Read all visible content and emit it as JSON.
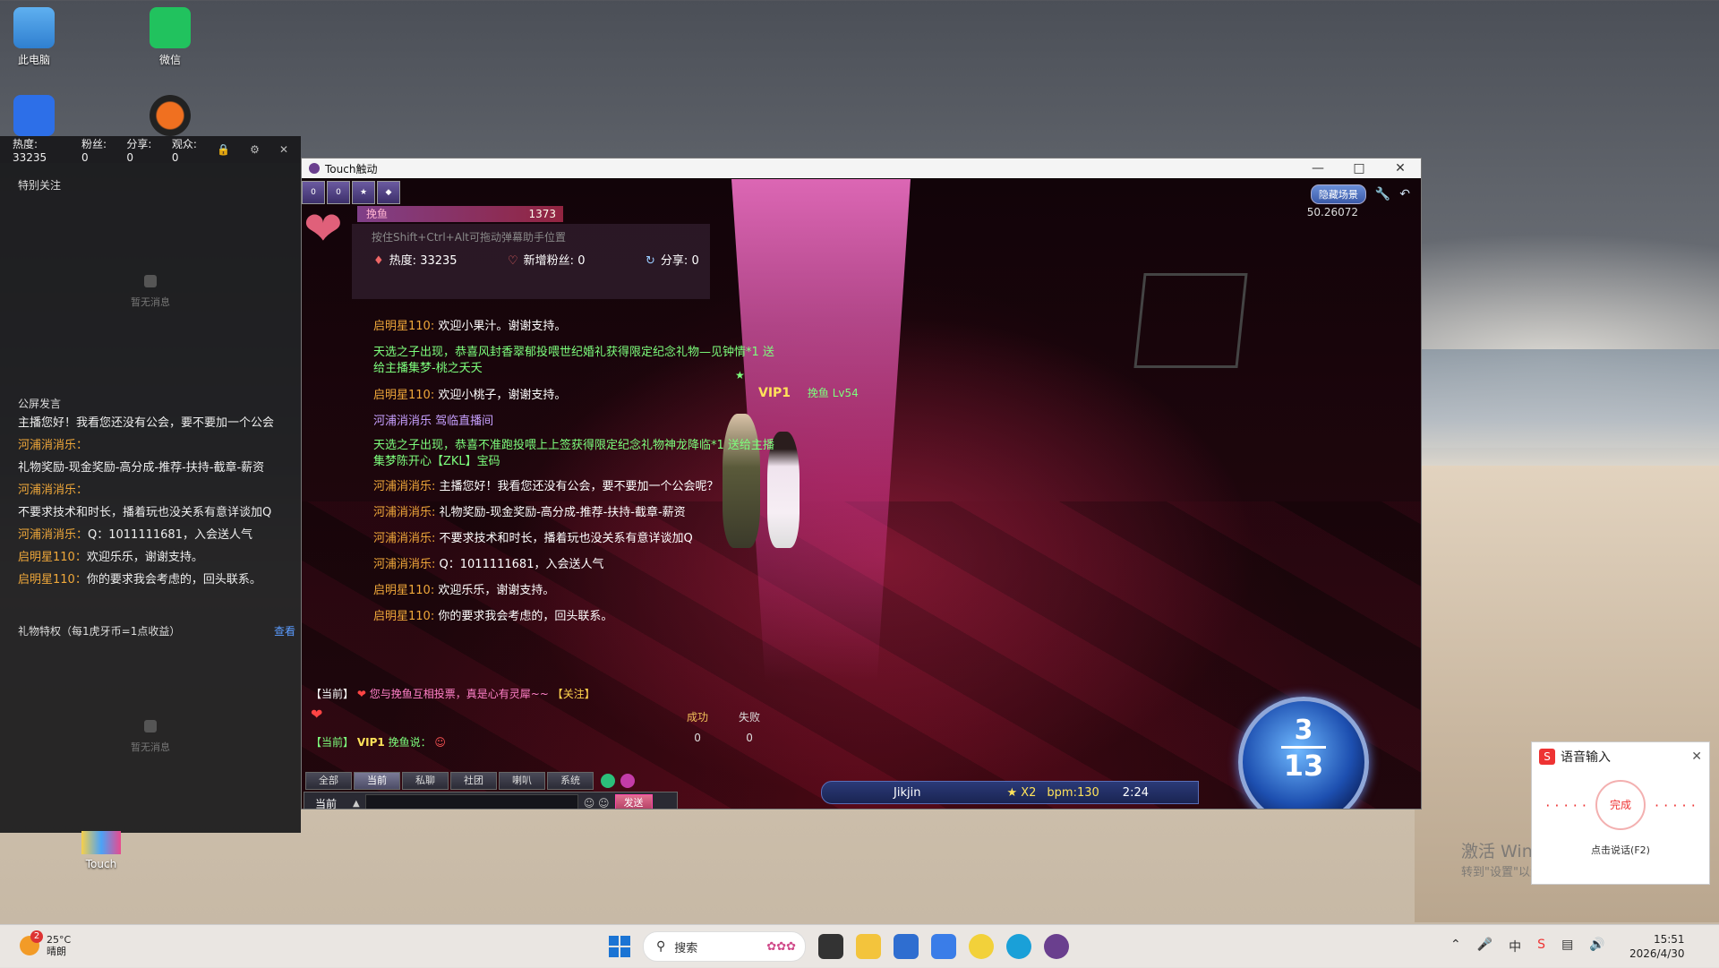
{
  "desktop": {
    "icons": [
      {
        "label": "此电脑",
        "color": "#3a8fd8"
      },
      {
        "label": "微信",
        "color": "#21c25e"
      },
      {
        "label": "",
        "color": "#2d6fe8"
      },
      {
        "label": "",
        "color": "#f07020"
      }
    ],
    "touch_label": "Touch"
  },
  "streamer_panel": {
    "stats": [
      {
        "label": "热度:",
        "value": "33235"
      },
      {
        "label": "粉丝:",
        "value": "0"
      },
      {
        "label": "分享:",
        "value": "0"
      },
      {
        "label": "观众:",
        "value": "0"
      }
    ],
    "special_follow": "特别关注",
    "empty_text": "暂无消息",
    "public_title": "公屏发言",
    "public_messages": [
      {
        "user": "",
        "text": "主播您好！我看您还没有公会，要不要加一个公会"
      },
      {
        "user": "河浦消消乐：",
        "text": ""
      },
      {
        "user": "",
        "text": "礼物奖励-现金奖励-高分成-推荐-扶持-截章-薪资"
      },
      {
        "user": "河浦消消乐：",
        "text": ""
      },
      {
        "user": "",
        "text": "不要求技术和时长，播着玩也没关系有意详谈加Q"
      },
      {
        "user": "河浦消消乐：",
        "text": "Q：1011111681，入会送人气"
      },
      {
        "user": "启明星110：",
        "text": "欢迎乐乐，谢谢支持。"
      },
      {
        "user": "启明星110：",
        "text": "你的要求我会考虑的，回头联系。"
      }
    ],
    "gift_privilege": "礼物特权（每1虎牙币=1点收益）",
    "gift_more": "查看",
    "empty_text_2": "暂无消息"
  },
  "game_window": {
    "title": "Touch触动",
    "hud": {
      "player_name": "挽鱼",
      "player_value": "1373",
      "hint": "按住Shift+Ctrl+Alt可拖动弹幕助手位置",
      "heat_label": "热度:",
      "heat_value": "33235",
      "fans_label": "新增粉丝:",
      "fans_value": "0",
      "share_label": "分享:",
      "share_value": "0",
      "hide_scene": "隐藏场景",
      "fps": "50.26072"
    },
    "chat": [
      {
        "user": "启明星110:",
        "text": " 欢迎小果汁。谢谢支持。",
        "kind": "normal"
      },
      {
        "text": "天选之子出现，恭喜风封香翠郁投喂世纪婚礼获得限定纪念礼物—见钟情*1 送给主播集梦-桃之夭夭",
        "kind": "system"
      },
      {
        "user": "启明星110:",
        "text": " 欢迎小桃子，谢谢支持。",
        "kind": "normal"
      },
      {
        "text": "河浦消消乐 驾临直播间",
        "kind": "enter"
      },
      {
        "text": "天选之子出现，恭喜不准跑投喂上上签获得限定纪念礼物神龙降临*1 送给主播集梦陈开心【ZKL】宝码",
        "kind": "system"
      },
      {
        "user": "河浦消消乐:",
        "text": " 主播您好！我看您还没有公会，要不要加一个公会呢？",
        "kind": "normal"
      },
      {
        "user": "河浦消消乐:",
        "text": " 礼物奖励-现金奖励-高分成-推荐-扶持-截章-薪资",
        "kind": "normal"
      },
      {
        "user": "河浦消消乐:",
        "text": " 不要求技术和时长，播着玩也没关系有意详谈加Q",
        "kind": "normal"
      },
      {
        "user": "河浦消消乐:",
        "text": " Q：1011111681，入会送人气",
        "kind": "normal"
      },
      {
        "user": "启明星110:",
        "text": " 欢迎乐乐，谢谢支持。",
        "kind": "normal"
      },
      {
        "user": "启明星110:",
        "text": " 你的要求我会考虑的，回头联系。",
        "kind": "normal"
      }
    ],
    "current_msg_1": {
      "tag": "【当前】",
      "text": "您与挽鱼互相投票，真是心有灵犀~~",
      "follow": "【关注】"
    },
    "current_msg_2": {
      "tag": "【当前】",
      "vip": "VIP1",
      "text": "挽鱼说："
    },
    "character": {
      "vip": "VIP1",
      "name": "挽鱼 Lv54"
    },
    "score": {
      "success_label": "成功",
      "fail_label": "失败",
      "success": "0",
      "fail": "0"
    },
    "song": {
      "name": "Jikjin",
      "multiplier": "X2",
      "bpm": "bpm:130",
      "time": "2:24"
    },
    "combo": {
      "top": "3",
      "bottom": "13"
    },
    "chat_tabs": [
      {
        "label": "全部",
        "active": false
      },
      {
        "label": "当前",
        "active": true
      },
      {
        "label": "私聊",
        "active": false
      },
      {
        "label": "社团",
        "active": false
      },
      {
        "label": "喇叭",
        "active": false
      },
      {
        "label": "系统",
        "active": false
      }
    ],
    "channel": "当前",
    "send": "发送"
  },
  "voice_input": {
    "title": "语音输入",
    "done": "完成",
    "tip": "点击说话(F2)"
  },
  "watermark": {
    "line1": "激活 Windows",
    "line2": "转到\"设置\"以激活 Windows。"
  },
  "taskbar": {
    "temp": "25°C",
    "weather": "晴朗",
    "weather_badge": "2",
    "search": "搜索",
    "time": "15:51",
    "date": "2026/4/30"
  }
}
